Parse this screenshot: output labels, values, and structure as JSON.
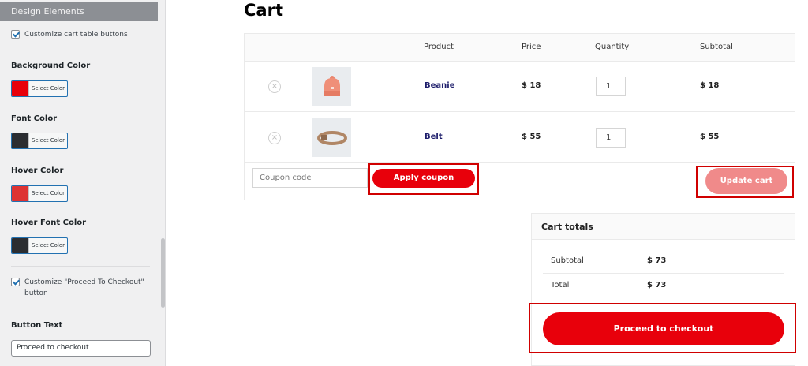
{
  "sidebar": {
    "header": "Design Elements",
    "customize_buttons_label": "Customize cart table buttons",
    "background_color": {
      "label": "Background Color",
      "picker_text": "Select Color",
      "swatch": "#e8000b"
    },
    "font_color": {
      "label": "Font Color",
      "picker_text": "Select Color",
      "swatch": "#2b2d31"
    },
    "hover_color": {
      "label": "Hover Color",
      "picker_text": "Select Color",
      "swatch": "#dd3333"
    },
    "hover_font_color": {
      "label": "Hover Font Color",
      "picker_text": "Select Color",
      "swatch": "#2b2d31"
    },
    "customize_checkout_label": "Customize \"Proceed To Checkout\"",
    "customize_checkout_label_line2": "button",
    "button_text_label": "Button Text",
    "button_text_value": "Proceed to checkout"
  },
  "cart": {
    "title": "Cart",
    "columns": {
      "product": "Product",
      "price": "Price",
      "quantity": "Quantity",
      "subtotal": "Subtotal"
    },
    "items": [
      {
        "name": "Beanie",
        "price": "$ 18",
        "qty": "1",
        "subtotal": "$ 18",
        "remove": "×",
        "icon": "beanie-icon"
      },
      {
        "name": "Belt",
        "price": "$ 55",
        "qty": "1",
        "subtotal": "$ 55",
        "remove": "×",
        "icon": "belt-icon"
      }
    ],
    "coupon_placeholder": "Coupon code",
    "apply_coupon": "Apply coupon",
    "update_cart": "Update cart"
  },
  "totals": {
    "title": "Cart totals",
    "subtotal_label": "Subtotal",
    "subtotal_value": "$ 73",
    "total_label": "Total",
    "total_value": "$ 73",
    "checkout_button": "Proceed to checkout"
  },
  "colors": {
    "accent": "#e8000b",
    "update_button": "#f08a8a",
    "highlight_outline": "#d00000"
  }
}
